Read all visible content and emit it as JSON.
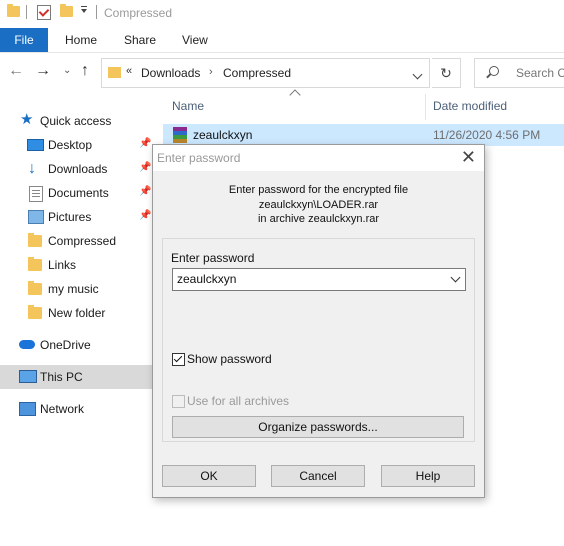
{
  "window": {
    "title": "Compressed"
  },
  "ribbon": {
    "tabs": [
      "File",
      "Home",
      "Share",
      "View"
    ]
  },
  "address": {
    "chevron": "«",
    "crumbs": [
      "Downloads",
      "Compressed"
    ],
    "crumb_sep": "›",
    "search_placeholder": "Search Co"
  },
  "sidebar": {
    "quick_access": "Quick access",
    "items": [
      "Desktop",
      "Downloads",
      "Documents",
      "Pictures",
      "Compressed",
      "Links",
      "my music",
      "New folder"
    ],
    "onedrive": "OneDrive",
    "thispc": "This PC",
    "network": "Network"
  },
  "filelist": {
    "columns": {
      "name": "Name",
      "date": "Date modified"
    },
    "rows": [
      {
        "name": "zeaulckxyn",
        "date": "11/26/2020 4:56 PM"
      }
    ]
  },
  "dialog": {
    "title": "Enter password",
    "message_lines": [
      "Enter password for the encrypted file",
      "zeaulckxyn\\LOADER.rar",
      "in archive zeaulckxyn.rar"
    ],
    "password_label": "Enter password",
    "password_value": "zeaulckxyn",
    "show_password_label": "Show password",
    "show_password_checked": true,
    "use_all_label": "Use for all archives",
    "use_all_enabled": false,
    "organize_label": "Organize passwords...",
    "ok_label": "OK",
    "cancel_label": "Cancel",
    "help_label": "Help"
  },
  "icons": {
    "titlebar": [
      "folder-icon",
      "properties-check-icon",
      "new-folder-icon",
      "customize-dropdown-icon"
    ],
    "nav": [
      "back-arrow-icon",
      "forward-arrow-icon",
      "recent-dropdown-icon",
      "up-arrow-icon",
      "refresh-icon",
      "search-icon"
    ]
  },
  "colors": {
    "accent": "#1a6fc4",
    "selection": "#cce8ff",
    "folder": "#f4c55b"
  }
}
